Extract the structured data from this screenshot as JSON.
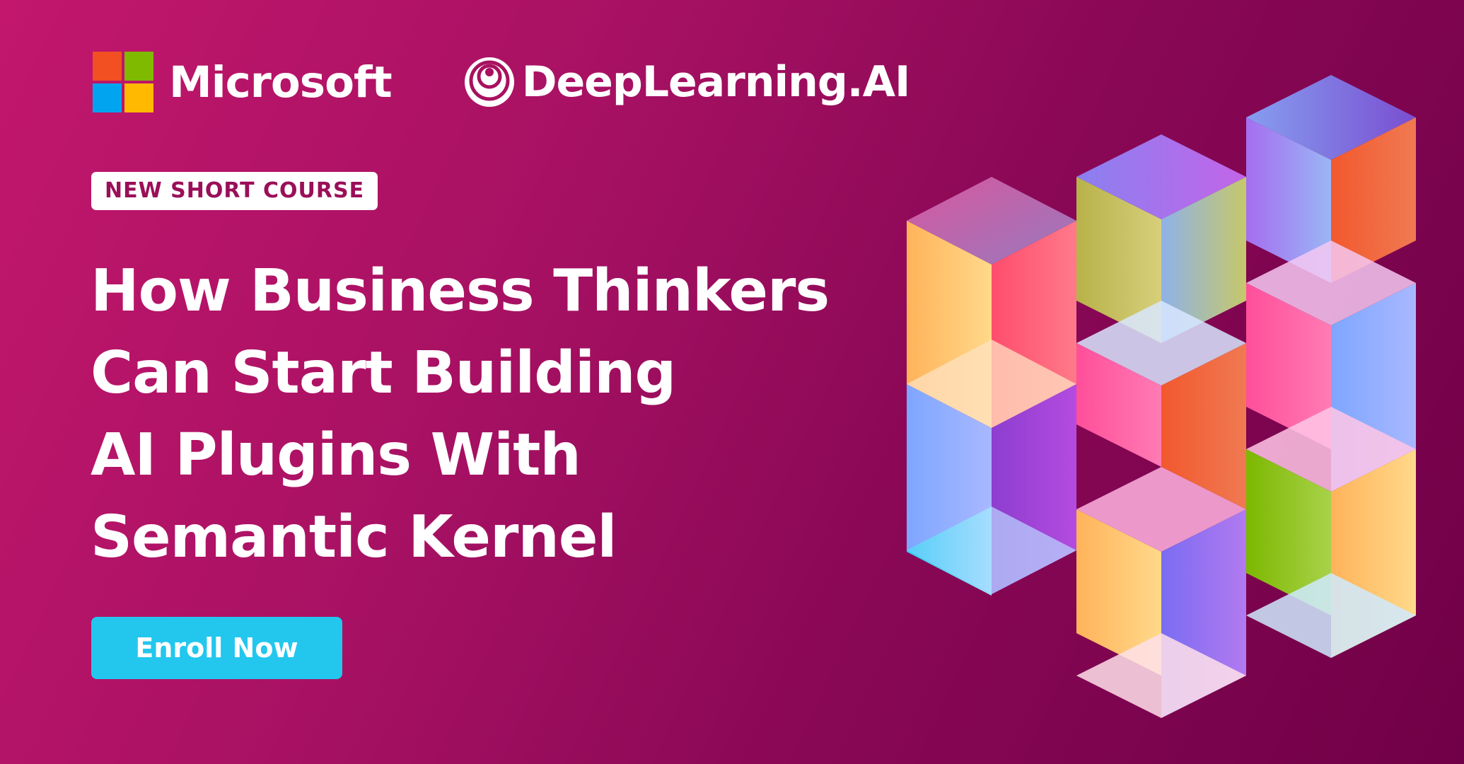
{
  "logos": {
    "microsoft": {
      "name": "Microsoft",
      "colors": [
        "#f25022",
        "#7fba00",
        "#00a4ef",
        "#ffb900"
      ]
    },
    "deeplearning": {
      "name": "DeepLearning.AI"
    }
  },
  "badge": "NEW SHORT COURSE",
  "headline": [
    "How Business Thinkers",
    "Can Start Building",
    "AI Plugins With",
    "Semantic Kernel"
  ],
  "cta": "Enroll Now",
  "colors": {
    "background_start": "#c2176c",
    "background_end": "#700047",
    "badge_text": "#9a0f58",
    "cta": "#23c7ee"
  }
}
